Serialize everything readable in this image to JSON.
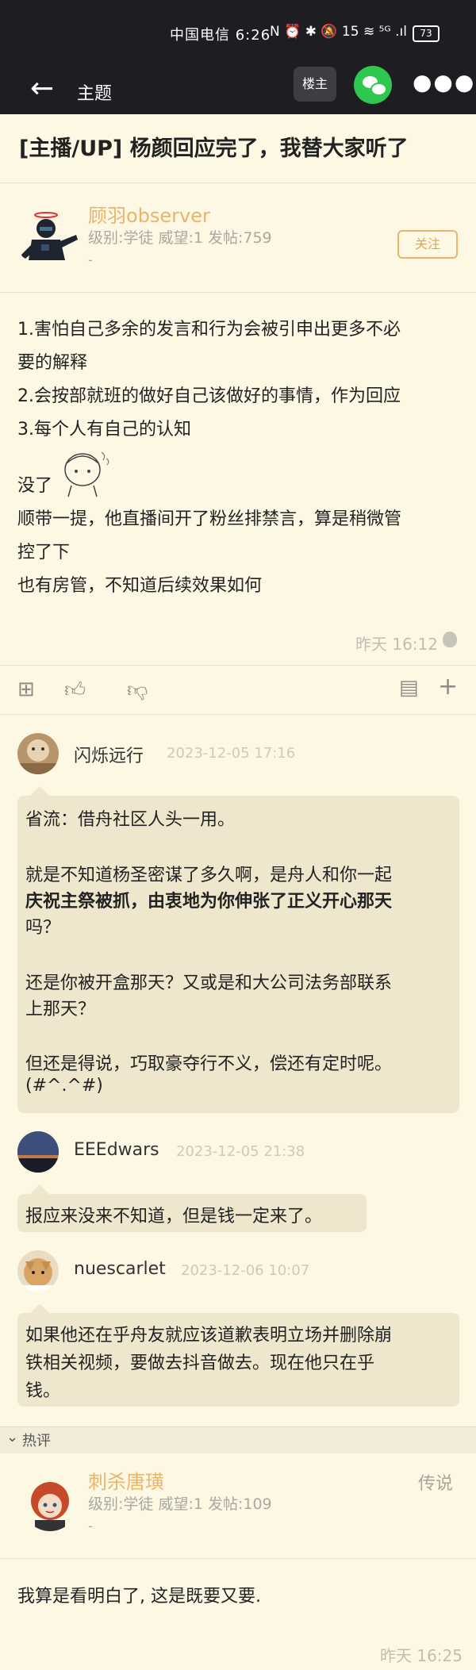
{
  "status_bar": {
    "carrier_time": "中国电信 6:26",
    "status_icons": "N ⏰ ✱ 🔕 15 ≋ ⁵ᴳ .ıl",
    "battery": "73"
  },
  "header": {
    "title": "主题",
    "louzhu_label": "楼主"
  },
  "topic": {
    "title": "[主播/UP] 杨颜回应完了，我替大家听了"
  },
  "op": {
    "name": "顾羽observer",
    "stats": "级别:学徒 威望:1 发帖:759",
    "dash": "-",
    "follow_label": "关注",
    "lines": [
      "1.害怕自己多余的发言和行为会被引申出更多不必",
      "要的解释",
      "2.会按部就班的做好自己该做好的事情，作为回应",
      "3.每个人有自己的认知",
      "没了",
      "顺带一提，他直播间开了粉丝排禁言，算是稍微管",
      "控了下",
      "也有房管，不知道后续效果如何"
    ],
    "time": "昨天 16:12"
  },
  "comments": [
    {
      "name": "闪烁远行",
      "time": "2023-12-05 17:16",
      "lines": [
        "省流：借舟社区人头一用。",
        "",
        "就是不知道杨圣密谋了多久啊，是舟人和你一起",
        "庆祝主祭被抓，由衷地为你伸张了正义开心那天",
        "吗？",
        "",
        "还是你被开盒那天？又或是和大公司法务部联系",
        "上那天？",
        "",
        "但还是得说，巧取豪夺行不义，偿还有定时呢。",
        "(#^.^#)"
      ]
    },
    {
      "name": "EEEdwars",
      "time": "2023-12-05 21:38",
      "lines": [
        "报应来没来不知道，但是钱一定来了。"
      ]
    },
    {
      "name": "nuescarlet",
      "time": "2023-12-06 10:07",
      "lines": [
        "如果他还在乎舟友就应该道歉表明立场并删除崩",
        "铁相关视频，要做去抖音做去。现在他只在乎",
        "钱。"
      ]
    }
  ],
  "hot": {
    "label": "热评",
    "name": "刺杀唐璜",
    "badge": "传说",
    "stats": "级别:学徒 威望:1 发帖:109",
    "dash": "-",
    "content": "我算是看明白了, 这是既要又要.",
    "time": "昨天 16:25"
  },
  "colors": {
    "background": "#fdf8e4",
    "accent": "#e8b56a",
    "bar": "#1d1d22",
    "wechat": "#2dc84d"
  }
}
